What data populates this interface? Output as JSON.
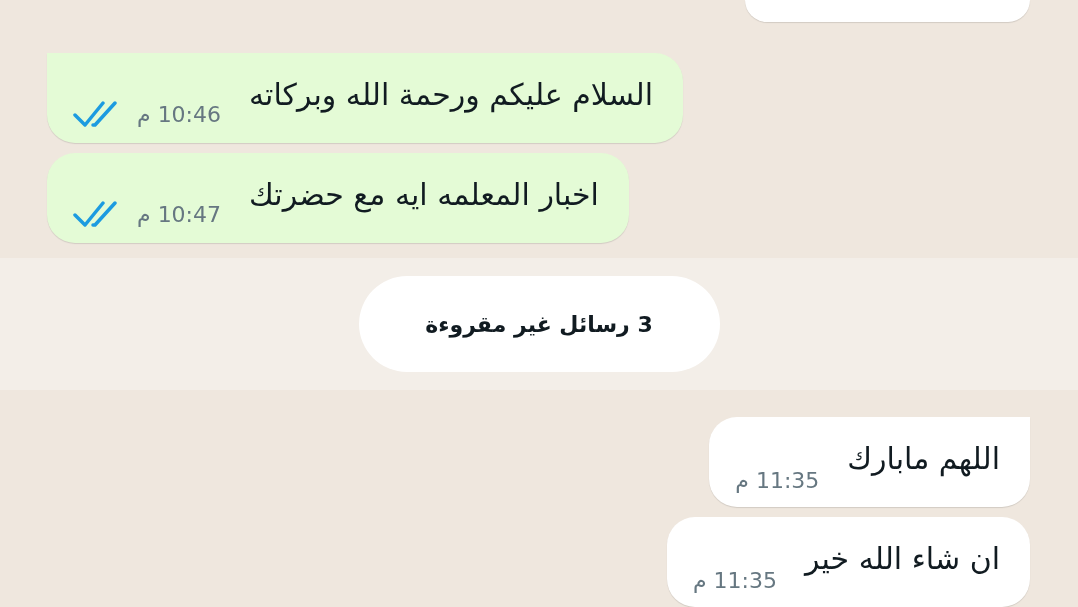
{
  "messages_top": [
    {
      "kind": "outgoing",
      "text": "السلام عليكم ورحمة الله وبركاته",
      "time": "10:46 م",
      "read": true,
      "tail": true
    },
    {
      "kind": "outgoing",
      "text": "اخبار المعلمه ايه مع حضرتك",
      "time": "10:47 م",
      "read": true,
      "tail": false
    }
  ],
  "unread_banner": {
    "text": "3 رسائل غير مقروءة"
  },
  "messages_bottom": [
    {
      "kind": "incoming",
      "text": "اللهم مابارك",
      "time": "11:35 م",
      "tail": true
    },
    {
      "kind": "incoming",
      "text": "ان شاء الله خير",
      "time": "11:35 م",
      "tail": false
    }
  ]
}
